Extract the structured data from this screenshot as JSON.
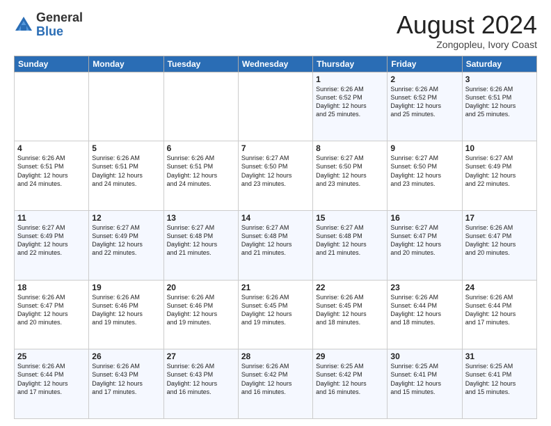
{
  "logo": {
    "general": "General",
    "blue": "Blue"
  },
  "title": "August 2024",
  "subtitle": "Zongopleu, Ivory Coast",
  "days_header": [
    "Sunday",
    "Monday",
    "Tuesday",
    "Wednesday",
    "Thursday",
    "Friday",
    "Saturday"
  ],
  "weeks": [
    [
      {
        "day": "",
        "info": ""
      },
      {
        "day": "",
        "info": ""
      },
      {
        "day": "",
        "info": ""
      },
      {
        "day": "",
        "info": ""
      },
      {
        "day": "1",
        "info": "Sunrise: 6:26 AM\nSunset: 6:52 PM\nDaylight: 12 hours\nand 25 minutes."
      },
      {
        "day": "2",
        "info": "Sunrise: 6:26 AM\nSunset: 6:52 PM\nDaylight: 12 hours\nand 25 minutes."
      },
      {
        "day": "3",
        "info": "Sunrise: 6:26 AM\nSunset: 6:51 PM\nDaylight: 12 hours\nand 25 minutes."
      }
    ],
    [
      {
        "day": "4",
        "info": "Sunrise: 6:26 AM\nSunset: 6:51 PM\nDaylight: 12 hours\nand 24 minutes."
      },
      {
        "day": "5",
        "info": "Sunrise: 6:26 AM\nSunset: 6:51 PM\nDaylight: 12 hours\nand 24 minutes."
      },
      {
        "day": "6",
        "info": "Sunrise: 6:26 AM\nSunset: 6:51 PM\nDaylight: 12 hours\nand 24 minutes."
      },
      {
        "day": "7",
        "info": "Sunrise: 6:27 AM\nSunset: 6:50 PM\nDaylight: 12 hours\nand 23 minutes."
      },
      {
        "day": "8",
        "info": "Sunrise: 6:27 AM\nSunset: 6:50 PM\nDaylight: 12 hours\nand 23 minutes."
      },
      {
        "day": "9",
        "info": "Sunrise: 6:27 AM\nSunset: 6:50 PM\nDaylight: 12 hours\nand 23 minutes."
      },
      {
        "day": "10",
        "info": "Sunrise: 6:27 AM\nSunset: 6:49 PM\nDaylight: 12 hours\nand 22 minutes."
      }
    ],
    [
      {
        "day": "11",
        "info": "Sunrise: 6:27 AM\nSunset: 6:49 PM\nDaylight: 12 hours\nand 22 minutes."
      },
      {
        "day": "12",
        "info": "Sunrise: 6:27 AM\nSunset: 6:49 PM\nDaylight: 12 hours\nand 22 minutes."
      },
      {
        "day": "13",
        "info": "Sunrise: 6:27 AM\nSunset: 6:48 PM\nDaylight: 12 hours\nand 21 minutes."
      },
      {
        "day": "14",
        "info": "Sunrise: 6:27 AM\nSunset: 6:48 PM\nDaylight: 12 hours\nand 21 minutes."
      },
      {
        "day": "15",
        "info": "Sunrise: 6:27 AM\nSunset: 6:48 PM\nDaylight: 12 hours\nand 21 minutes."
      },
      {
        "day": "16",
        "info": "Sunrise: 6:27 AM\nSunset: 6:47 PM\nDaylight: 12 hours\nand 20 minutes."
      },
      {
        "day": "17",
        "info": "Sunrise: 6:26 AM\nSunset: 6:47 PM\nDaylight: 12 hours\nand 20 minutes."
      }
    ],
    [
      {
        "day": "18",
        "info": "Sunrise: 6:26 AM\nSunset: 6:47 PM\nDaylight: 12 hours\nand 20 minutes."
      },
      {
        "day": "19",
        "info": "Sunrise: 6:26 AM\nSunset: 6:46 PM\nDaylight: 12 hours\nand 19 minutes."
      },
      {
        "day": "20",
        "info": "Sunrise: 6:26 AM\nSunset: 6:46 PM\nDaylight: 12 hours\nand 19 minutes."
      },
      {
        "day": "21",
        "info": "Sunrise: 6:26 AM\nSunset: 6:45 PM\nDaylight: 12 hours\nand 19 minutes."
      },
      {
        "day": "22",
        "info": "Sunrise: 6:26 AM\nSunset: 6:45 PM\nDaylight: 12 hours\nand 18 minutes."
      },
      {
        "day": "23",
        "info": "Sunrise: 6:26 AM\nSunset: 6:44 PM\nDaylight: 12 hours\nand 18 minutes."
      },
      {
        "day": "24",
        "info": "Sunrise: 6:26 AM\nSunset: 6:44 PM\nDaylight: 12 hours\nand 17 minutes."
      }
    ],
    [
      {
        "day": "25",
        "info": "Sunrise: 6:26 AM\nSunset: 6:44 PM\nDaylight: 12 hours\nand 17 minutes."
      },
      {
        "day": "26",
        "info": "Sunrise: 6:26 AM\nSunset: 6:43 PM\nDaylight: 12 hours\nand 17 minutes."
      },
      {
        "day": "27",
        "info": "Sunrise: 6:26 AM\nSunset: 6:43 PM\nDaylight: 12 hours\nand 16 minutes."
      },
      {
        "day": "28",
        "info": "Sunrise: 6:26 AM\nSunset: 6:42 PM\nDaylight: 12 hours\nand 16 minutes."
      },
      {
        "day": "29",
        "info": "Sunrise: 6:25 AM\nSunset: 6:42 PM\nDaylight: 12 hours\nand 16 minutes."
      },
      {
        "day": "30",
        "info": "Sunrise: 6:25 AM\nSunset: 6:41 PM\nDaylight: 12 hours\nand 15 minutes."
      },
      {
        "day": "31",
        "info": "Sunrise: 6:25 AM\nSunset: 6:41 PM\nDaylight: 12 hours\nand 15 minutes."
      }
    ]
  ]
}
